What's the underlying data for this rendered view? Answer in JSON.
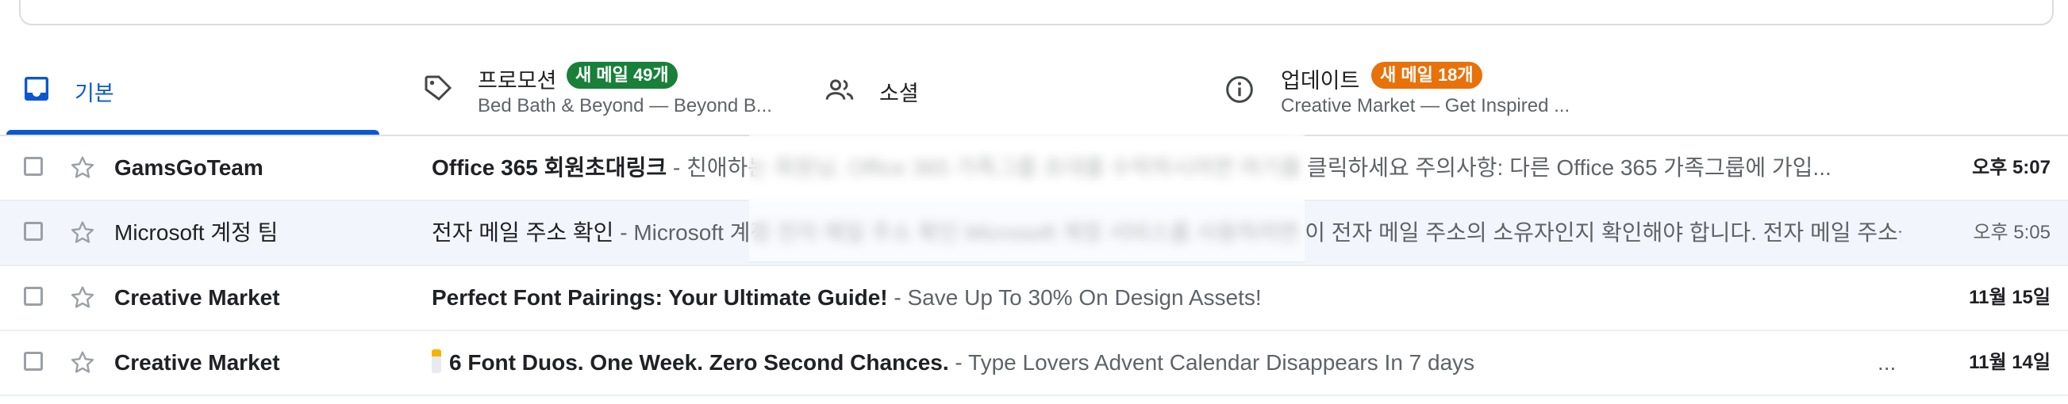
{
  "tabs": [
    {
      "name": "기본",
      "badge": "",
      "sub": "",
      "icon": "inbox-icon"
    },
    {
      "name": "프로모션",
      "badge": "새 메일 49개",
      "sub": "Bed Bath & Beyond — Beyond B...",
      "icon": "tag-icon"
    },
    {
      "name": "소셜",
      "badge": "",
      "sub": "",
      "icon": "people-icon"
    },
    {
      "name": "업데이트",
      "badge": "새 메일 18개",
      "sub": "Creative Market — Get Inspired ...",
      "icon": "info-icon"
    }
  ],
  "colors": {
    "accent": "#0b57d0",
    "promotions_badge": "#188038",
    "updates_badge": "#e8710a",
    "read_row_bg": "#f2f6fc"
  },
  "emails": [
    {
      "sender": "GamsGoTeam",
      "subject": "Office 365 회원초대링크",
      "snippet": "친애하는 회원님. Office 365 가족그룹 초대를 수락하시려면 여기를 클릭하세요 주의사항: 다른 Office 365 가족그룹에 가입...",
      "date": "오후 5:07",
      "unread": true,
      "ellipsis": ""
    },
    {
      "sender": "Microsoft 계정 팀",
      "subject": "전자 메일 주소 확인",
      "snippet": "Microsoft 계정 전자 메일 주소 확인 Microsoft 계정 서비스를 사용하려면 이 전자 메일 주소의 소유자인지 확인해야 합니다. 전자 메일 주소를 ...",
      "date": "오후 5:05",
      "unread": false,
      "ellipsis": ""
    },
    {
      "sender": "Creative Market",
      "subject": "Perfect Font Pairings: Your Ultimate Guide!",
      "snippet": "Save Up To 30% On Design Assets!",
      "date": "11월 15일",
      "unread": true,
      "ellipsis": ""
    },
    {
      "sender": "Creative Market",
      "subject": "6 Font Duos. One Week. Zero Second Chances.",
      "snippet": "Type Lovers Advent Calendar Disappears In 7 days",
      "date": "11월 14일",
      "unread": true,
      "ellipsis": "..."
    }
  ],
  "separator": " - "
}
